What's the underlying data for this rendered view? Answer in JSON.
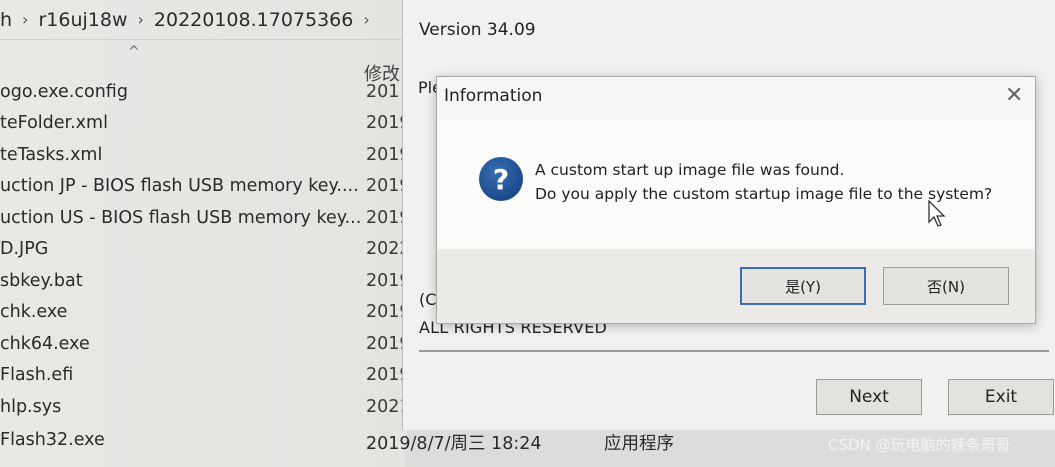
{
  "explorer": {
    "breadcrumb": {
      "leading_fragment": "h",
      "items": [
        "r16uj18w",
        "20220108.17075366"
      ]
    },
    "column_modified_label": "修改",
    "files": [
      {
        "name": "ogo.exe.config",
        "date": "201"
      },
      {
        "name": "teFolder.xml",
        "date": "2019"
      },
      {
        "name": "teTasks.xml",
        "date": "2019"
      },
      {
        "name": "uction JP - BIOS flash USB memory key....",
        "date": "2019"
      },
      {
        "name": "uction US - BIOS flash USB memory key...",
        "date": "2019"
      },
      {
        "name": "D.JPG",
        "date": "2022"
      },
      {
        "name": "sbkey.bat",
        "date": "2019"
      },
      {
        "name": "chk.exe",
        "date": "2019"
      },
      {
        "name": "chk64.exe",
        "date": "2019"
      },
      {
        "name": "Flash.efi",
        "date": "2019"
      },
      {
        "name": "hlp.sys",
        "date": "2021"
      }
    ],
    "bottom_file": {
      "name": "Flash32.exe",
      "date": "2019/8/7/周三 18:24",
      "type": "应用程序"
    }
  },
  "installer": {
    "version": "Version 34.09",
    "please_fragment": "Ple",
    "copyright_fragment": "(C)",
    "all_rights": "ALL RIGHTS RESERVED",
    "next_label": "Next",
    "exit_label": "Exit"
  },
  "dialog": {
    "title": "Information",
    "close_glyph": "✕",
    "icon": "question-icon",
    "icon_glyph": "?",
    "message_line1": "A custom start up image file was found.",
    "message_line2": "Do you apply the custom startup image file to the system?",
    "yes_label": "是(Y)",
    "no_label": "否(N)"
  },
  "watermark": "CSDN @玩电脑的辣条哥哥",
  "colors": {
    "dialog_accent": "#3b6eb3",
    "question_icon": "#1a4a8c"
  }
}
